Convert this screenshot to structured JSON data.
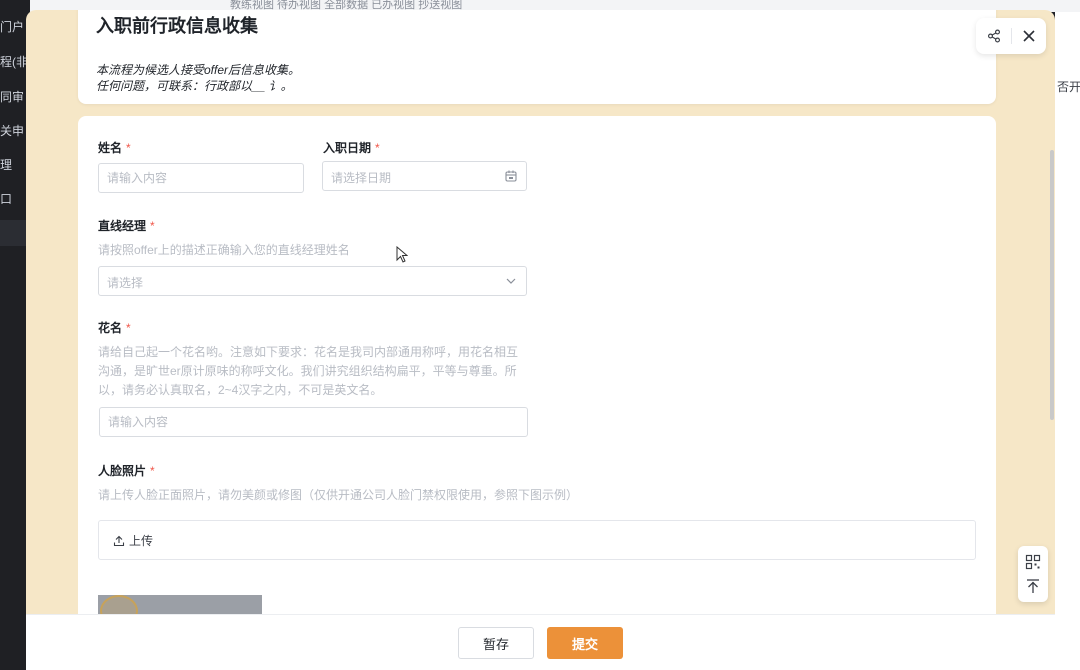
{
  "background": {
    "sidebar_items": [
      "门户",
      "程(非",
      "同审",
      "关申",
      "理",
      "口"
    ],
    "top_text": "教练视图   待办视图   全部数据   已办视图   抄送视图",
    "right_peek": "否开"
  },
  "header": {
    "title": "入职前行政信息收集",
    "description_line1": "本流程为候选人接受offer后信息收集。",
    "description_line2": "任何问题，可联系：行政部以__ 讠。"
  },
  "actions": {
    "share_icon": "share-icon",
    "close_icon": "close-icon"
  },
  "form": {
    "name": {
      "label": "姓名",
      "required": "*",
      "placeholder": "请输入内容"
    },
    "entry_date": {
      "label": "入职日期",
      "required": "*",
      "placeholder": "请选择日期"
    },
    "manager": {
      "label": "直线经理",
      "required": "*",
      "hint": "请按照offer上的描述正确输入您的直线经理姓名",
      "placeholder": "请选择"
    },
    "nickname": {
      "label": "花名",
      "required": "*",
      "hint_line1": "请给自己起一个花名哟。注意如下要求：花名是我司内部通用称呼，用花名相互",
      "hint_line2": "沟通，是旷世er原计原味的称呼文化。我们讲究组织结构扁平，平等与尊重。所",
      "hint_line3": "以，请务必认真取名，2~4汉字之内，不可是英文名。",
      "placeholder": "请输入内容"
    },
    "face_photo": {
      "label": "人脸照片",
      "required": "*",
      "hint": "请上传人脸正面照片，请勿美颜或修图（仅供开通公司人脸门禁权限使用，参照下图示例）",
      "upload_label": "上传"
    }
  },
  "footer": {
    "save_label": "暂存",
    "submit_label": "提交"
  },
  "colors": {
    "accent": "#ec9139",
    "modal_bg": "#f6e7c7",
    "required": "#f0574a"
  }
}
